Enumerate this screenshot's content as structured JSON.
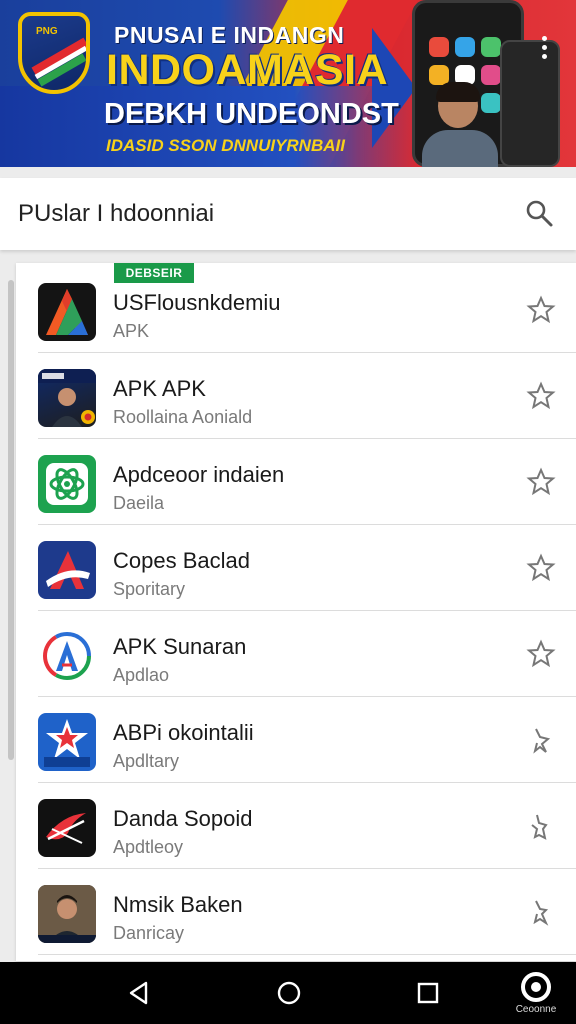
{
  "banner": {
    "line1": "PNUSAI E INDANGN",
    "line2": "INDOAMASIA",
    "line3": "DEBKH UNDEONDST",
    "line4": "IDASID SSON DNNUIYRNBAII",
    "logo_text": "PNG"
  },
  "search": {
    "text": "PUslar I hdoonniai"
  },
  "list": {
    "featured_badge": "DEBSEIR",
    "items": [
      {
        "title": "USFlousnkdemiu",
        "subtitle": "APK",
        "icon": "a-logo-icon"
      },
      {
        "title": "APK APK",
        "subtitle": "Roollaina Aoniald",
        "icon": "portrait-icon"
      },
      {
        "title": "Apdceoor indaien",
        "subtitle": "Daeila",
        "icon": "atom-icon"
      },
      {
        "title": "Copes Baclad",
        "subtitle": "Sporitary",
        "icon": "a-flag-icon"
      },
      {
        "title": "APK Sunaran",
        "subtitle": "Apdlao",
        "icon": "a-circle-icon"
      },
      {
        "title": "ABPi okointalii",
        "subtitle": "Apdltary",
        "icon": "star-badge-icon"
      },
      {
        "title": "Danda Sopoid",
        "subtitle": "Apdtleoy",
        "icon": "swoosh-icon"
      },
      {
        "title": "Nmsik Baken",
        "subtitle": "Danricay",
        "icon": "portrait-icon"
      }
    ]
  },
  "navbar": {
    "assistant_label": "Ceoonne"
  },
  "colors": {
    "accent_green": "#1a9a49",
    "banner_blue": "#1e4bb0",
    "banner_red": "#d8262e",
    "banner_yellow": "#f8d21a"
  }
}
